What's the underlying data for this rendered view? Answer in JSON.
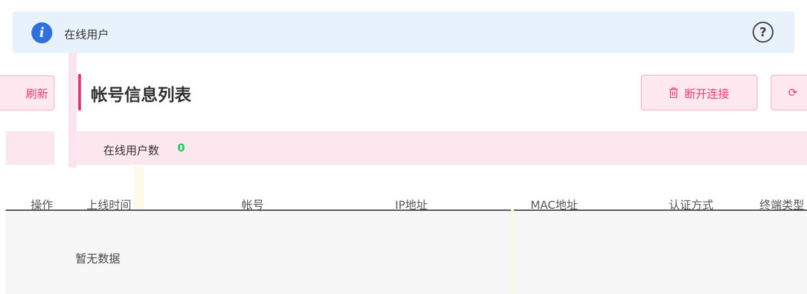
{
  "info_bar": {
    "title": "在线用户",
    "icon": "info-icon",
    "help_icon": "question-circle-icon",
    "help_glyph": "?"
  },
  "left_panel": {
    "refresh_label": "刷新"
  },
  "main": {
    "title": "帐号信息列表",
    "disconnect_label": "断开连接",
    "disconnect_icon": "trash-icon",
    "refresh_icon": "refresh-icon",
    "refresh_glyph": "⟳"
  },
  "online": {
    "label": "在线用户数",
    "count": "0"
  },
  "table": {
    "columns": [
      "操作",
      "上线时间",
      "帐号",
      "IP地址",
      "MAC地址",
      "认证方式",
      "终端类型"
    ],
    "empty_text": "暂无数据"
  },
  "colors": {
    "accent": "#e8336e",
    "count_green": "#1dd15f",
    "info_blue": "#2f6fe0"
  }
}
